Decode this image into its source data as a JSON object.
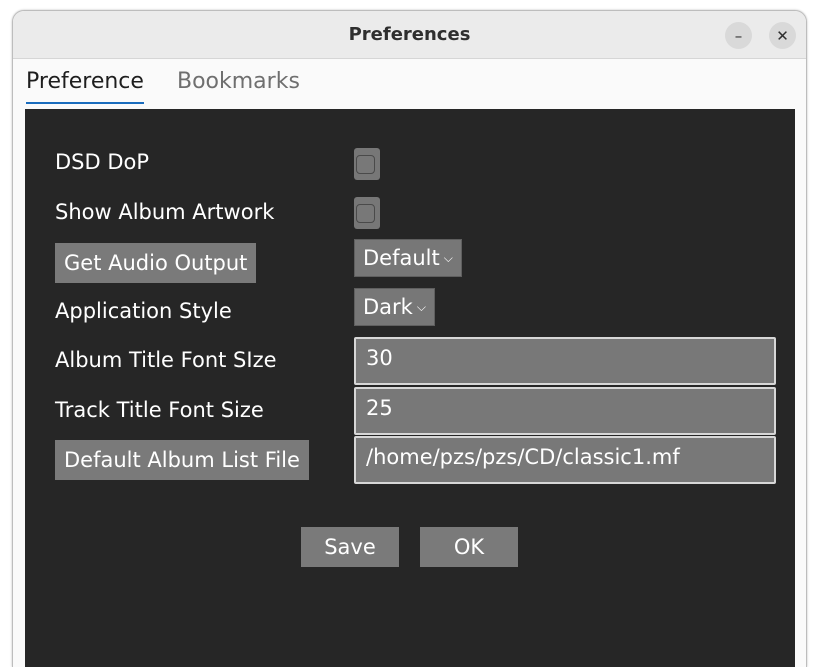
{
  "window": {
    "title": "Preferences",
    "minimize_glyph": "–",
    "close_glyph": "✕"
  },
  "tabs": [
    {
      "label": "Preference",
      "active": true
    },
    {
      "label": "Bookmarks",
      "active": false
    }
  ],
  "form": {
    "dsd_dop_label": "DSD DoP",
    "dsd_dop_checked": false,
    "show_artwork_label": "Show Album Artwork",
    "show_artwork_checked": false,
    "get_audio_output_label": "Get Audio Output",
    "audio_output_value": "Default",
    "app_style_label": "Application Style",
    "app_style_value": "Dark",
    "album_font_label": "Album Title Font SIze",
    "album_font_value": "30",
    "track_font_label": "Track Title Font Size",
    "track_font_value": "25",
    "album_list_button_label": "Default Album List File",
    "album_list_value": "/home/pzs/pzs/CD/classic1.mf",
    "dropdown_glyph": "⌵"
  },
  "actions": {
    "save_label": "Save",
    "ok_label": "OK"
  },
  "colors": {
    "panel_bg": "#262626",
    "button_bg": "#7a7a7a",
    "tab_underline": "#1a6cbd"
  }
}
